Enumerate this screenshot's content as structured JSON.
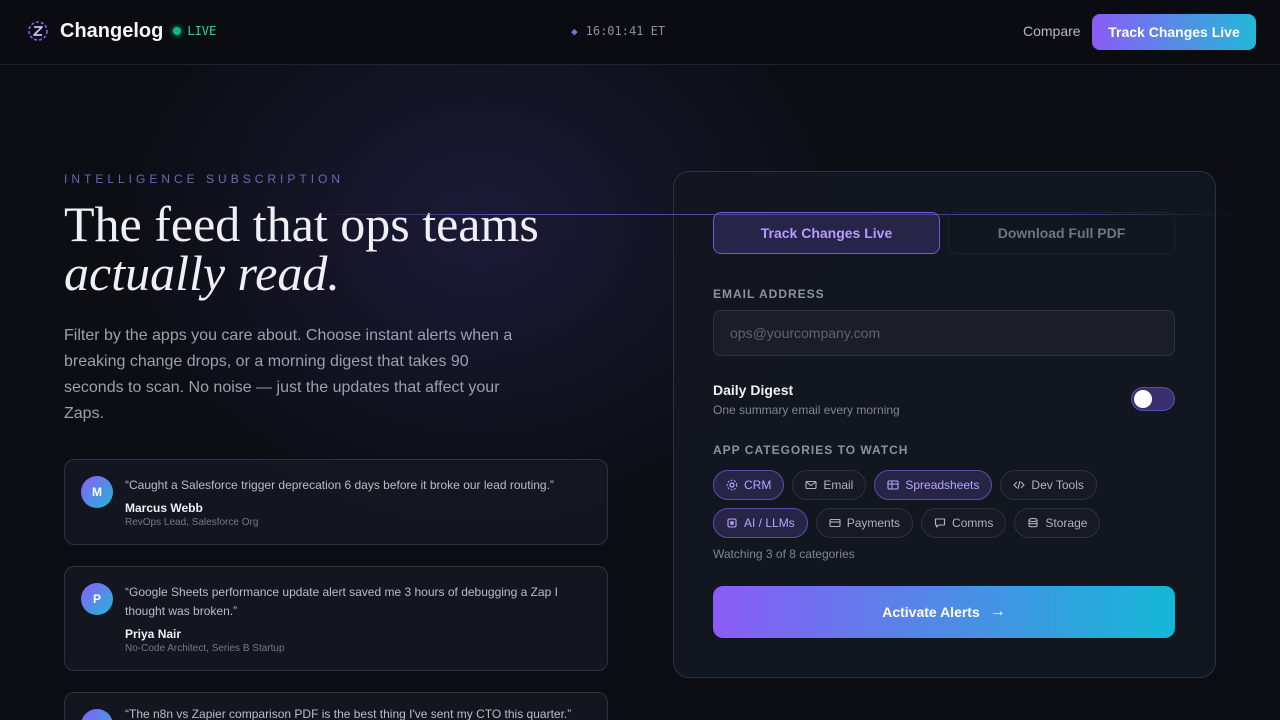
{
  "header": {
    "brand": "Changelog",
    "live_label": "LIVE",
    "clock": "16:01:41 ET",
    "compare_label": "Compare",
    "cta_label": "Track Changes Live"
  },
  "hero": {
    "eyebrow": "INTELLIGENCE SUBSCRIPTION",
    "headline_line1": "The feed that ops teams",
    "headline_line2": "actually read.",
    "lede": "Filter by the apps you care about. Choose instant alerts when a breaking change drops, or a morning digest that takes 90 seconds to scan. No noise — just the updates that affect your Zaps."
  },
  "testimonials": [
    {
      "initial": "M",
      "quote": "“Caught a Salesforce trigger deprecation 6 days before it broke our lead routing.”",
      "name": "Marcus Webb",
      "role": "RevOps Lead, Salesforce Org"
    },
    {
      "initial": "P",
      "quote": "“Google Sheets performance update alert saved me 3 hours of debugging a Zap I thought was broken.”",
      "name": "Priya Nair",
      "role": "No-Code Architect, Series B Startup"
    },
    {
      "initial": "",
      "quote": "“The n8n vs Zapier comparison PDF is the best thing I've sent my CTO this quarter.”",
      "name": "",
      "role": ""
    }
  ],
  "form": {
    "tabs": [
      "Track Changes Live",
      "Download Full PDF"
    ],
    "email_label": "EMAIL ADDRESS",
    "email_placeholder": "ops@yourcompany.com",
    "email_value": "",
    "digest_title": "Daily Digest",
    "digest_sub": "One summary email every morning",
    "digest_enabled": false,
    "categories_label": "APP CATEGORIES TO WATCH",
    "categories": [
      {
        "label": "CRM",
        "icon": "crm-icon",
        "selected": true
      },
      {
        "label": "Email",
        "icon": "email-icon",
        "selected": false
      },
      {
        "label": "Spreadsheets",
        "icon": "spreadsheet-icon",
        "selected": true
      },
      {
        "label": "Dev Tools",
        "icon": "code-icon",
        "selected": false
      },
      {
        "label": "AI / LLMs",
        "icon": "ai-chip-icon",
        "selected": true
      },
      {
        "label": "Payments",
        "icon": "card-icon",
        "selected": false
      },
      {
        "label": "Comms",
        "icon": "chat-icon",
        "selected": false
      },
      {
        "label": "Storage",
        "icon": "database-icon",
        "selected": false
      }
    ],
    "watching_text": "Watching 3 of 8 categories",
    "submit_label": "Activate Alerts",
    "submit_arrow": "→"
  },
  "colors": {
    "accent_purple": "#8b5cf6",
    "accent_cyan": "#22b8d8",
    "live_green": "#10b981",
    "background": "#0b0d12"
  }
}
